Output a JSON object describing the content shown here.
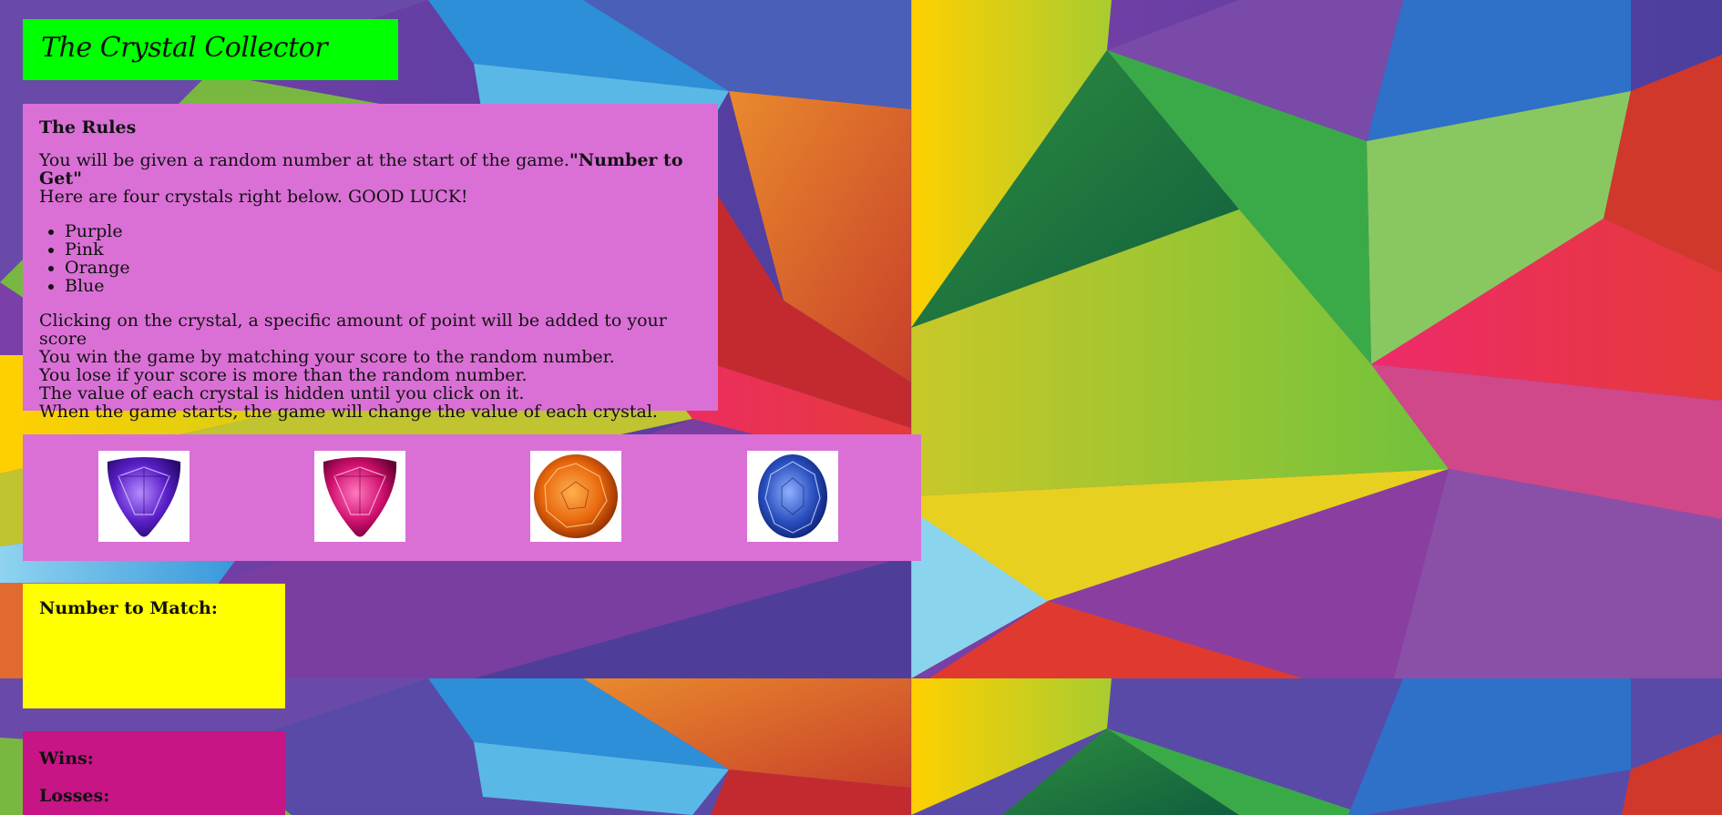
{
  "header": {
    "title": "The Crystal Collector"
  },
  "rules": {
    "heading": "The Rules",
    "intro_text": "You will be given a random number at the start of the game.",
    "intro_bold": "\"Number to Get\"",
    "intro_line2": "Here are four crystals right below. GOOD LUCK!",
    "crystal_names": [
      "Purple",
      "Pink",
      "Orange",
      "Blue"
    ],
    "details": [
      "Clicking on the crystal, a specific amount of point will be added to your score",
      "You win the game by matching your score to the random number.",
      "You lose if your score is more than the random number.",
      "The value of each crystal is hidden until you click on it.",
      "When the game starts, the game will change the value of each crystal."
    ]
  },
  "crystals": [
    {
      "icon": "purple-crystal-icon",
      "color": "#6a2bd8"
    },
    {
      "icon": "pink-crystal-icon",
      "color": "#d0106e"
    },
    {
      "icon": "orange-crystal-icon",
      "color": "#e8660c"
    },
    {
      "icon": "blue-crystal-icon",
      "color": "#2a4fbf"
    }
  ],
  "target": {
    "label": "Number to Match:",
    "value": ""
  },
  "score": {
    "wins_label": "Wins:",
    "losses_label": "Losses:"
  },
  "colors": {
    "title_bg": "#00ff00",
    "panel_bg": "#da70d6",
    "target_bg": "#ffff00",
    "score_bg": "#c71585"
  }
}
